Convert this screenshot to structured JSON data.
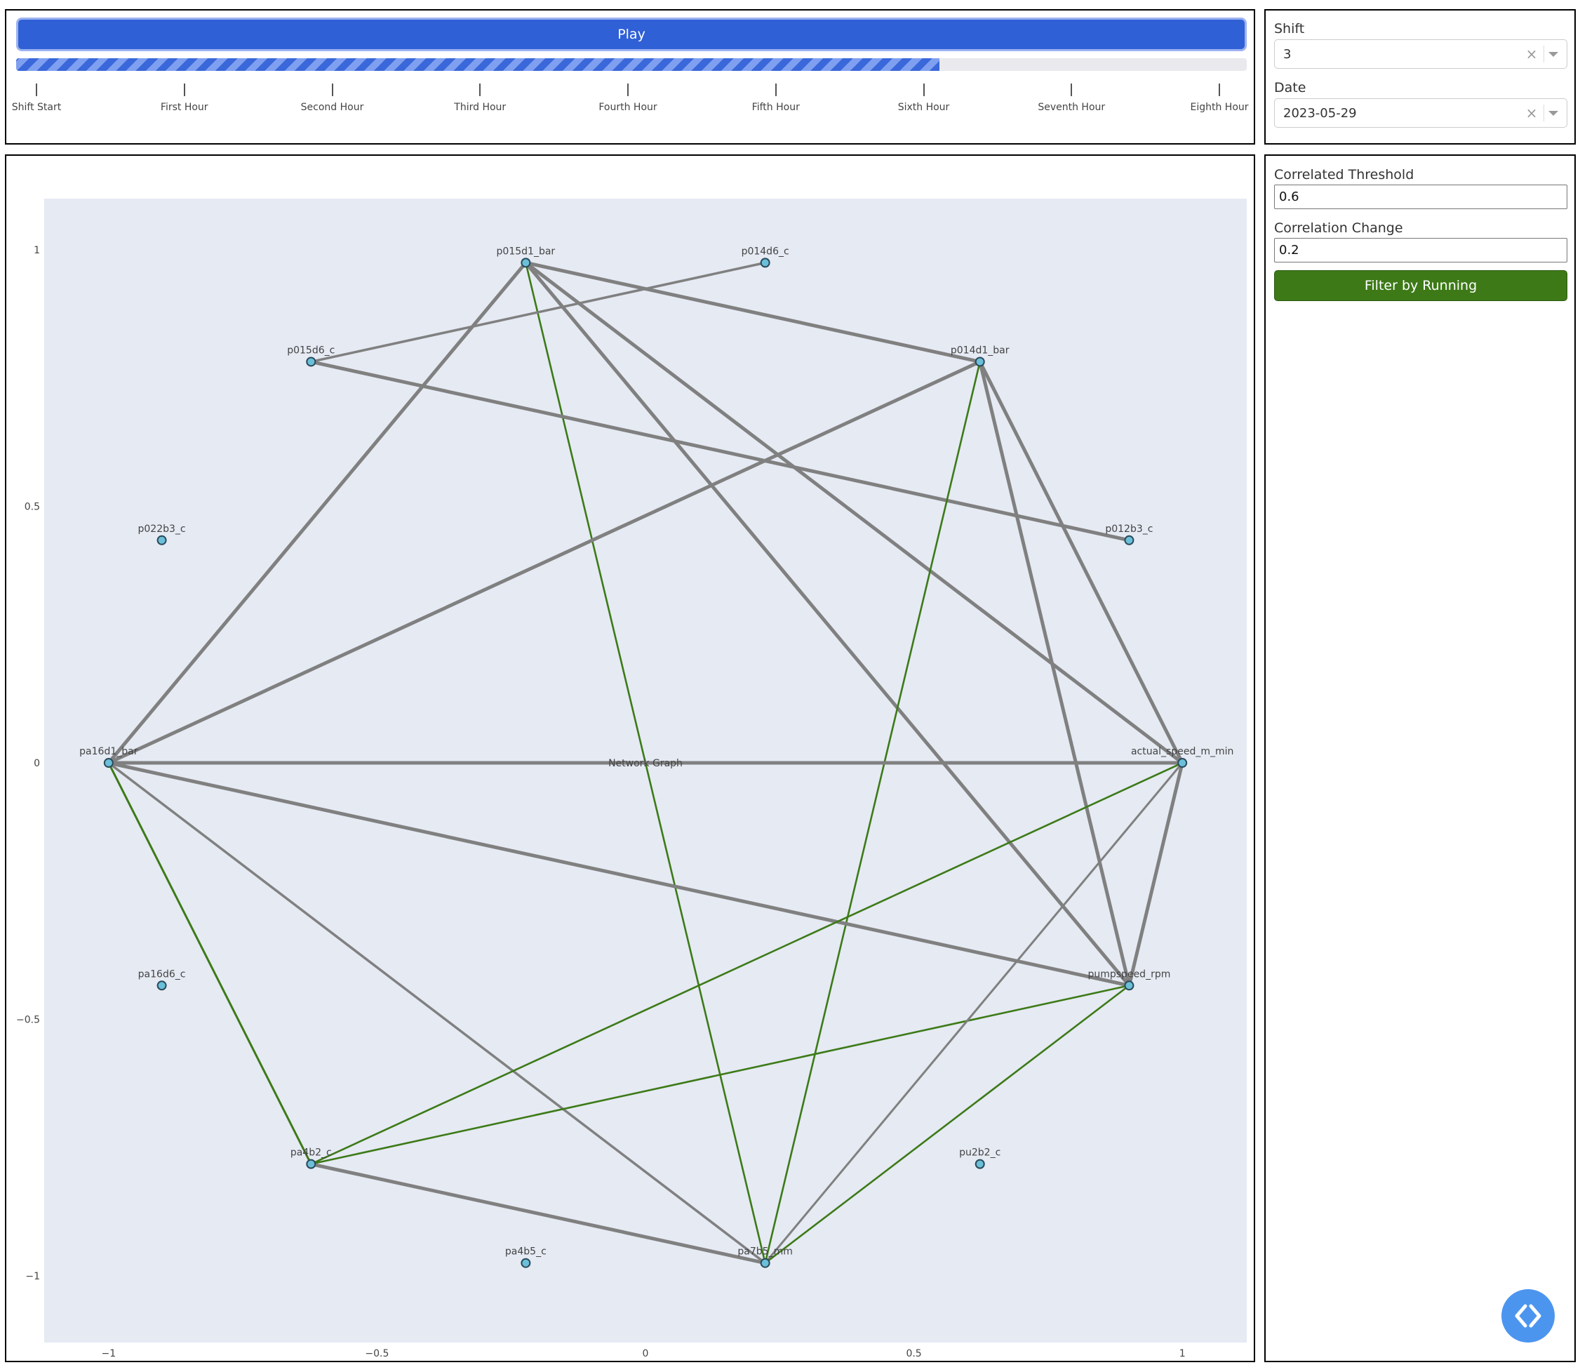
{
  "player": {
    "play_label": "Play",
    "progress_fraction": 0.75,
    "ticks": [
      "Shift Start",
      "First Hour",
      "Second Hour",
      "Third Hour",
      "Fourth Hour",
      "Fifth Hour",
      "Sixth Hour",
      "Seventh Hour",
      "Eighth Hour"
    ]
  },
  "selectors": {
    "shift": {
      "label": "Shift",
      "value": "3",
      "clear_icon": "×"
    },
    "date": {
      "label": "Date",
      "value": "2023-05-29",
      "clear_icon": "×"
    }
  },
  "filters": {
    "threshold_label": "Correlated Threshold",
    "threshold_value": "0.6",
    "change_label": "Correlation Change",
    "change_value": "0.2",
    "button_label": "Filter by Running"
  },
  "colors": {
    "edge_gray": "#808080",
    "edge_green": "#3d7a17",
    "node_fill": "#6bbfd9",
    "plot_bg": "#e5eaf3",
    "accent_blue": "#3060d6"
  },
  "chart_data": {
    "type": "network",
    "center_label": "Network Graph",
    "xlim": [
      -1.12,
      1.12
    ],
    "ylim": [
      -1.13,
      1.1
    ],
    "x_ticks": [
      -1,
      -0.5,
      0,
      0.5,
      1
    ],
    "x_tick_labels": [
      "−1",
      "−0.5",
      "0",
      "0.5",
      "1"
    ],
    "y_ticks": [
      1,
      0.5,
      0,
      -0.5,
      -1
    ],
    "y_tick_labels": [
      "1",
      "0.5",
      "0",
      "−0.5",
      "−1"
    ],
    "nodes": [
      {
        "name": "actual_speed_m_min",
        "x": 1.0,
        "y": 0.0
      },
      {
        "name": "p012b3_c",
        "x": 0.901,
        "y": 0.434
      },
      {
        "name": "p014d1_bar",
        "x": 0.623,
        "y": 0.782
      },
      {
        "name": "p014d6_c",
        "x": 0.223,
        "y": 0.975
      },
      {
        "name": "p015d1_bar",
        "x": -0.223,
        "y": 0.975
      },
      {
        "name": "p015d6_c",
        "x": -0.623,
        "y": 0.782
      },
      {
        "name": "p022b3_c",
        "x": -0.901,
        "y": 0.434
      },
      {
        "name": "pa16d1_bar",
        "x": -1.0,
        "y": 0.0
      },
      {
        "name": "pa16d6_c",
        "x": -0.901,
        "y": -0.434
      },
      {
        "name": "pa4b2_c",
        "x": -0.623,
        "y": -0.782
      },
      {
        "name": "pa4b5_c",
        "x": -0.223,
        "y": -0.975
      },
      {
        "name": "pa7b5_mm",
        "x": 0.223,
        "y": -0.975
      },
      {
        "name": "pu2b2_c",
        "x": 0.623,
        "y": -0.782
      },
      {
        "name": "pumpspeed_rpm",
        "x": 0.901,
        "y": -0.434
      }
    ],
    "edges": [
      {
        "source": "p015d1_bar",
        "target": "p014d1_bar",
        "color": "gray",
        "weight": 5
      },
      {
        "source": "p015d1_bar",
        "target": "pa16d1_bar",
        "color": "gray",
        "weight": 5
      },
      {
        "source": "p015d1_bar",
        "target": "pa7b5_mm",
        "color": "green",
        "weight": 2.6
      },
      {
        "source": "p015d1_bar",
        "target": "pumpspeed_rpm",
        "color": "gray",
        "weight": 5
      },
      {
        "source": "p015d1_bar",
        "target": "actual_speed_m_min",
        "color": "gray",
        "weight": 5
      },
      {
        "source": "p015d6_c",
        "target": "p014d6_c",
        "color": "gray",
        "weight": 3.5
      },
      {
        "source": "p015d6_c",
        "target": "p012b3_c",
        "color": "gray",
        "weight": 5
      },
      {
        "source": "p014d1_bar",
        "target": "pa16d1_bar",
        "color": "gray",
        "weight": 5
      },
      {
        "source": "p014d1_bar",
        "target": "pa7b5_mm",
        "color": "green",
        "weight": 2.6
      },
      {
        "source": "p014d1_bar",
        "target": "actual_speed_m_min",
        "color": "gray",
        "weight": 5
      },
      {
        "source": "p014d1_bar",
        "target": "pumpspeed_rpm",
        "color": "gray",
        "weight": 5
      },
      {
        "source": "pa16d1_bar",
        "target": "actual_speed_m_min",
        "color": "gray",
        "weight": 5
      },
      {
        "source": "pa16d1_bar",
        "target": "pumpspeed_rpm",
        "color": "gray",
        "weight": 5
      },
      {
        "source": "pa16d1_bar",
        "target": "pa4b2_c",
        "color": "green",
        "weight": 3
      },
      {
        "source": "pa16d1_bar",
        "target": "pa7b5_mm",
        "color": "gray",
        "weight": 3.5
      },
      {
        "source": "pa4b2_c",
        "target": "actual_speed_m_min",
        "color": "green",
        "weight": 2.6
      },
      {
        "source": "pa4b2_c",
        "target": "pumpspeed_rpm",
        "color": "green",
        "weight": 2.6
      },
      {
        "source": "pa4b2_c",
        "target": "pa7b5_mm",
        "color": "gray",
        "weight": 5
      },
      {
        "source": "pa7b5_mm",
        "target": "actual_speed_m_min",
        "color": "gray",
        "weight": 3
      },
      {
        "source": "pa7b5_mm",
        "target": "pumpspeed_rpm",
        "color": "green",
        "weight": 2.6
      },
      {
        "source": "actual_speed_m_min",
        "target": "pumpspeed_rpm",
        "color": "gray",
        "weight": 5
      }
    ]
  }
}
